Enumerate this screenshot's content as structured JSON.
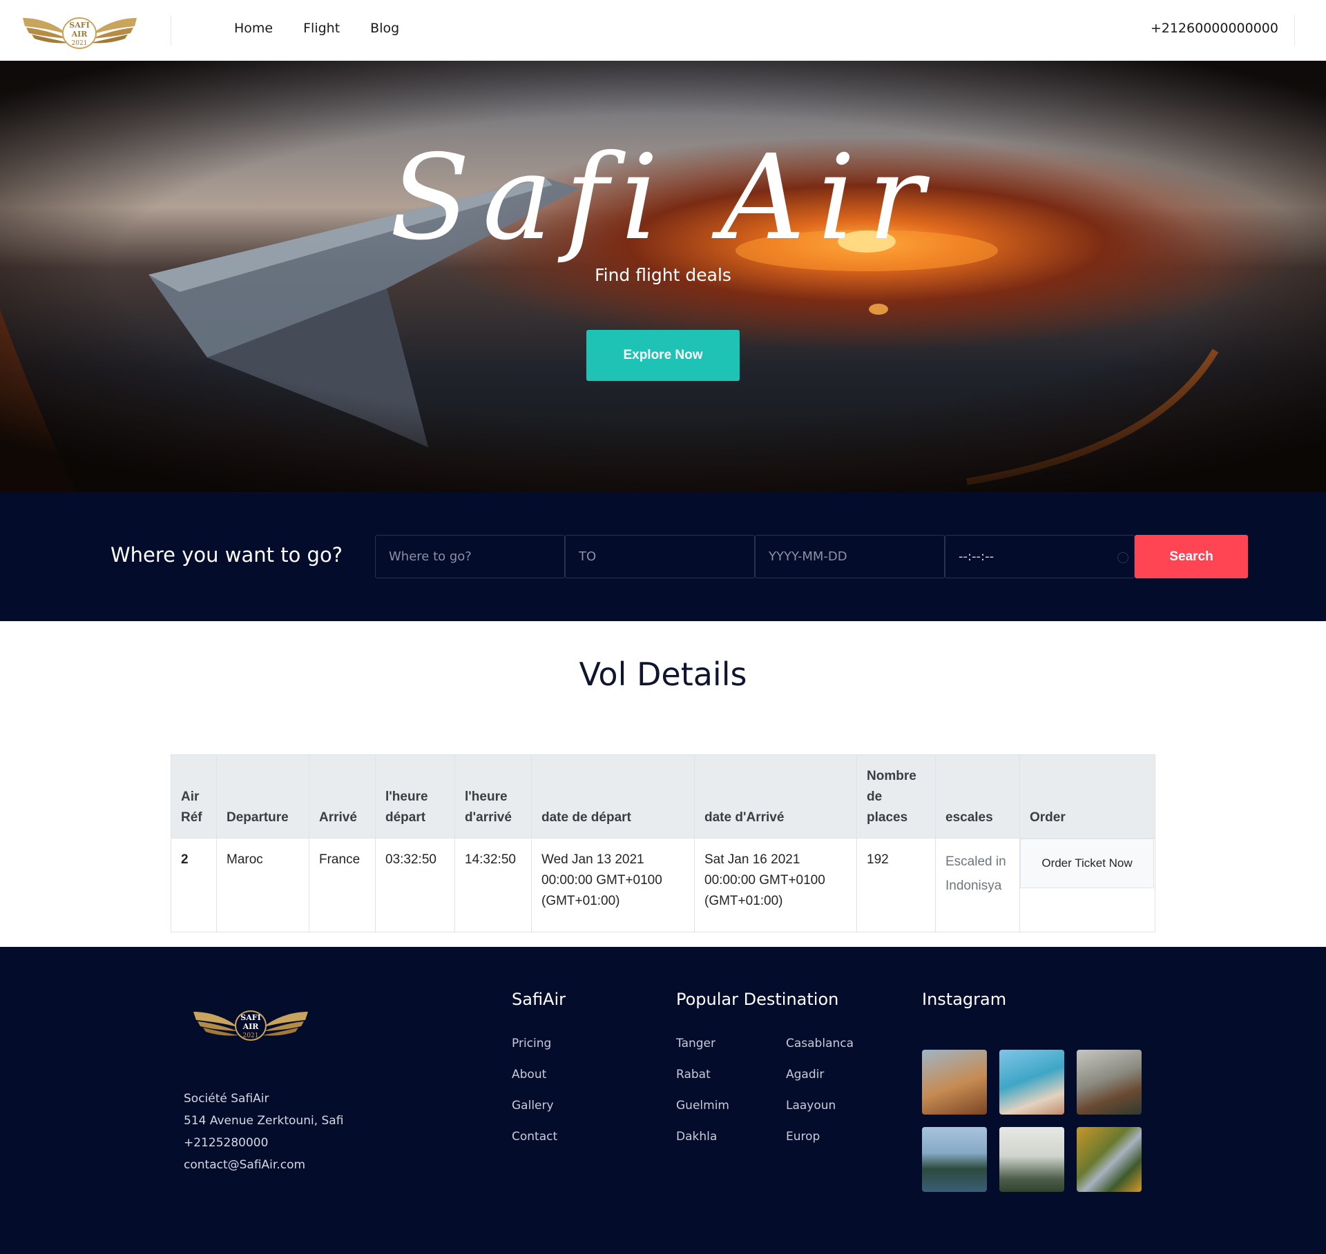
{
  "header": {
    "logo_text": "SAFI AIR 2021",
    "nav": [
      "Home",
      "Flight",
      "Blog"
    ],
    "phone": "+21260000000000"
  },
  "hero": {
    "title": "Safi Air",
    "subtitle": "Find flight deals",
    "cta": "Explore Now"
  },
  "search": {
    "title": "Where you want to go?",
    "fields": [
      {
        "placeholder": "Where to go?",
        "value": ""
      },
      {
        "placeholder": "TO",
        "value": ""
      },
      {
        "placeholder": "YYYY-MM-DD",
        "value": ""
      },
      {
        "placeholder": "",
        "value": "--:--:--"
      }
    ],
    "button": "Search"
  },
  "vol": {
    "title": "Vol Details",
    "columns": [
      "Air Réf",
      "Departure",
      "Arrivé",
      "l'heure départ",
      "l'heure d'arrivé",
      "date de départ",
      "date d'Arrivé",
      "Nombre de places",
      "escales",
      "Order"
    ],
    "rows": [
      {
        "ref": "2",
        "departure": "Maroc",
        "arrival": "France",
        "heure_depart": "03:32:50",
        "heure_arrive": "14:32:50",
        "date_depart": "Wed Jan 13 2021 00:00:00 GMT+0100 (GMT+01:00)",
        "date_arrive": "Sat Jan 16 2021 00:00:00 GMT+0100 (GMT+01:00)",
        "places": "192",
        "escales": "Escaled in Indonisya",
        "order": "Order Ticket Now"
      }
    ]
  },
  "footer": {
    "address": [
      "Société SafiAir",
      "514 Avenue Zerktouni, Safi",
      "+2125280000",
      "contact@SafiAir.com"
    ],
    "safiair": {
      "title": "SafiAir",
      "links": [
        "Pricing",
        "About",
        "Gallery",
        "Contact"
      ]
    },
    "destinations": {
      "title": "Popular Destination",
      "col1": [
        "Tanger",
        "Rabat",
        "Guelmim",
        "Dakhla"
      ],
      "col2": [
        "Casablanca",
        "Agadir",
        "Laayoun",
        "Europ"
      ]
    },
    "instagram": {
      "title": "Instagram"
    }
  },
  "colors": {
    "navy": "#040c2c",
    "teal": "#1fc3b6",
    "red": "#ff4554",
    "gold": "#c9a45c"
  }
}
